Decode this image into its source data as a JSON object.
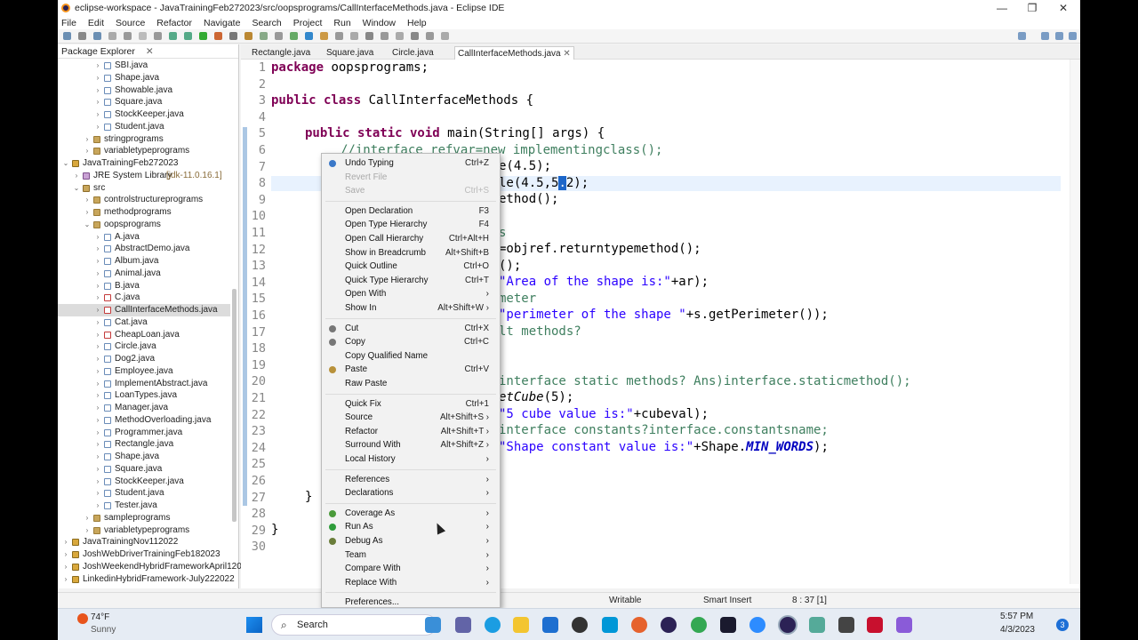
{
  "titlebar": {
    "title": "eclipse-workspace - JavaTrainingFeb272023/src/oopsprograms/CallInterfaceMethods.java - Eclipse IDE",
    "minimize": "—",
    "maximize": "❐",
    "close": "✕"
  },
  "menubar": [
    "File",
    "Edit",
    "Source",
    "Refactor",
    "Navigate",
    "Search",
    "Project",
    "Run",
    "Window",
    "Help"
  ],
  "package_explorer": {
    "title": "Package Explorer",
    "close": "✕",
    "rows": [
      {
        "label": "SBI.java",
        "indent": 3,
        "icon": "java",
        "arrow": ">"
      },
      {
        "label": "Shape.java",
        "indent": 3,
        "icon": "java",
        "arrow": ">"
      },
      {
        "label": "Showable.java",
        "indent": 3,
        "icon": "java",
        "arrow": ">"
      },
      {
        "label": "Square.java",
        "indent": 3,
        "icon": "java",
        "arrow": ">"
      },
      {
        "label": "StockKeeper.java",
        "indent": 3,
        "icon": "java",
        "arrow": ">"
      },
      {
        "label": "Student.java",
        "indent": 3,
        "icon": "java",
        "arrow": ">"
      },
      {
        "label": "stringprograms",
        "indent": 2,
        "icon": "pkg",
        "arrow": ">"
      },
      {
        "label": "variabletypeprograms",
        "indent": 2,
        "icon": "pkg",
        "arrow": ">"
      },
      {
        "label": "JavaTrainingFeb272023",
        "indent": 0,
        "icon": "proj",
        "arrow": "v"
      },
      {
        "label": "JRE System Library",
        "extra": "[jdk-11.0.16.1]",
        "indent": 1,
        "icon": "jre",
        "arrow": ">"
      },
      {
        "label": "src",
        "indent": 1,
        "icon": "src",
        "arrow": "v"
      },
      {
        "label": "controlstructureprograms",
        "indent": 2,
        "icon": "pkg",
        "arrow": ">"
      },
      {
        "label": "methodprograms",
        "indent": 2,
        "icon": "pkg",
        "arrow": ">"
      },
      {
        "label": "oopsprograms",
        "indent": 2,
        "icon": "pkg",
        "arrow": "v"
      },
      {
        "label": "A.java",
        "indent": 3,
        "icon": "java",
        "arrow": ">"
      },
      {
        "label": "AbstractDemo.java",
        "indent": 3,
        "icon": "java",
        "arrow": ">"
      },
      {
        "label": "Album.java",
        "indent": 3,
        "icon": "java",
        "arrow": ">"
      },
      {
        "label": "Animal.java",
        "indent": 3,
        "icon": "java",
        "arrow": ">"
      },
      {
        "label": "B.java",
        "indent": 3,
        "icon": "java",
        "arrow": ">"
      },
      {
        "label": "C.java",
        "indent": 3,
        "icon": "err",
        "arrow": ">"
      },
      {
        "label": "CallInterfaceMethods.java",
        "indent": 3,
        "icon": "err",
        "arrow": ">",
        "selected": true
      },
      {
        "label": "Cat.java",
        "indent": 3,
        "icon": "java",
        "arrow": ">"
      },
      {
        "label": "CheapLoan.java",
        "indent": 3,
        "icon": "err",
        "arrow": ">"
      },
      {
        "label": "Circle.java",
        "indent": 3,
        "icon": "java",
        "arrow": ">"
      },
      {
        "label": "Dog2.java",
        "indent": 3,
        "icon": "java",
        "arrow": ">"
      },
      {
        "label": "Employee.java",
        "indent": 3,
        "icon": "java",
        "arrow": ">"
      },
      {
        "label": "ImplementAbstract.java",
        "indent": 3,
        "icon": "java",
        "arrow": ">"
      },
      {
        "label": "LoanTypes.java",
        "indent": 3,
        "icon": "java",
        "arrow": ">"
      },
      {
        "label": "Manager.java",
        "indent": 3,
        "icon": "java",
        "arrow": ">"
      },
      {
        "label": "MethodOverloading.java",
        "indent": 3,
        "icon": "java",
        "arrow": ">"
      },
      {
        "label": "Programmer.java",
        "indent": 3,
        "icon": "java",
        "arrow": ">"
      },
      {
        "label": "Rectangle.java",
        "indent": 3,
        "icon": "java",
        "arrow": ">"
      },
      {
        "label": "Shape.java",
        "indent": 3,
        "icon": "java",
        "arrow": ">"
      },
      {
        "label": "Square.java",
        "indent": 3,
        "icon": "java",
        "arrow": ">"
      },
      {
        "label": "StockKeeper.java",
        "indent": 3,
        "icon": "java",
        "arrow": ">"
      },
      {
        "label": "Student.java",
        "indent": 3,
        "icon": "java",
        "arrow": ">"
      },
      {
        "label": "Tester.java",
        "indent": 3,
        "icon": "java",
        "arrow": ">"
      },
      {
        "label": "sampleprograms",
        "indent": 2,
        "icon": "pkg",
        "arrow": ">"
      },
      {
        "label": "variabletypeprograms",
        "indent": 2,
        "icon": "pkg",
        "arrow": ">"
      },
      {
        "label": "JavaTrainingNov112022",
        "indent": 0,
        "icon": "proj",
        "arrow": ">"
      },
      {
        "label": "JoshWebDriverTrainingFeb182023",
        "indent": 0,
        "icon": "proj",
        "arrow": ">"
      },
      {
        "label": "JoshWeekendHybridFrameworkApril12023",
        "indent": 0,
        "icon": "proj",
        "arrow": ">"
      },
      {
        "label": "LinkedinHybridFramework-July222022",
        "indent": 0,
        "icon": "proj",
        "arrow": ">"
      }
    ]
  },
  "editor": {
    "tabs": [
      {
        "label": "Rectangle.java"
      },
      {
        "label": "Square.java"
      },
      {
        "label": "Circle.java"
      },
      {
        "label": "CallInterfaceMethods.java",
        "active": true
      }
    ],
    "line_numbers": [
      "1",
      "2",
      "3",
      "4",
      "5",
      "6",
      "7",
      "8",
      "9",
      "10",
      "11",
      "12",
      "13",
      "14",
      "15",
      "16",
      "17",
      "18",
      "19",
      "20",
      "21",
      "22",
      "23",
      "24",
      "25",
      "26",
      "27",
      "28",
      "29",
      "30"
    ],
    "code": {
      "l1_kw": "package",
      "l1_rest": " oopsprograms;",
      "l3_kw": "public class",
      "l3_rest": " CallInterfaceMethods {",
      "l5_kw": "public static void",
      "l5_rest": " main(String[] args) {",
      "l6": "//interface refvar=new implementingclass();",
      "l7": "e(4.5);",
      "l8_a": "le(4.5,5",
      "l8_sel": ".",
      "l8_b": "2);",
      "l9": "ethod();",
      "l11": "s",
      "l12": "=objref.returntypemethod();",
      "l13": "();",
      "l14_str": "\"Area of the shape is:\"",
      "l14_rest": "+ar);",
      "l15": "meter",
      "l16_str": "\"perimeter of the shape \"",
      "l16_rest": "+s.getPerimeter());",
      "l17": "lt methods?",
      "l20": "interface static methods? Ans)interface.staticmethod();",
      "l21_it": "etCube",
      "l21_rest": "(5);",
      "l22_str": "\"5 cube value is:\"",
      "l22_rest": "+cubeval);",
      "l23": "interface constants?interface.constantsname;",
      "l24_str": "\"Shape constant value is:\"",
      "l24_mid": "+Shape.",
      "l24_fld": "MIN_WORDS",
      "l24_end": ");",
      "l27": "}",
      "l29": "}"
    }
  },
  "context_menu": [
    {
      "label": "Undo Typing",
      "key": "Ctrl+Z",
      "icon": "undo"
    },
    {
      "label": "Revert File",
      "disabled": true
    },
    {
      "label": "Save",
      "key": "Ctrl+S",
      "disabled": true
    },
    {
      "sep": true
    },
    {
      "label": "Open Declaration",
      "key": "F3"
    },
    {
      "label": "Open Type Hierarchy",
      "key": "F4"
    },
    {
      "label": "Open Call Hierarchy",
      "key": "Ctrl+Alt+H"
    },
    {
      "label": "Show in Breadcrumb",
      "key": "Alt+Shift+B"
    },
    {
      "label": "Quick Outline",
      "key": "Ctrl+O"
    },
    {
      "label": "Quick Type Hierarchy",
      "key": "Ctrl+T"
    },
    {
      "label": "Open With",
      "sub": true
    },
    {
      "label": "Show In",
      "key": "Alt+Shift+W ›"
    },
    {
      "sep": true
    },
    {
      "label": "Cut",
      "key": "Ctrl+X",
      "icon": "cut"
    },
    {
      "label": "Copy",
      "key": "Ctrl+C",
      "icon": "copy"
    },
    {
      "label": "Copy Qualified Name"
    },
    {
      "label": "Paste",
      "key": "Ctrl+V",
      "icon": "paste"
    },
    {
      "label": "Raw Paste"
    },
    {
      "sep": true
    },
    {
      "label": "Quick Fix",
      "key": "Ctrl+1"
    },
    {
      "label": "Source",
      "key": "Alt+Shift+S ›"
    },
    {
      "label": "Refactor",
      "key": "Alt+Shift+T ›"
    },
    {
      "label": "Surround With",
      "key": "Alt+Shift+Z ›"
    },
    {
      "label": "Local History",
      "sub": true
    },
    {
      "sep": true
    },
    {
      "label": "References",
      "sub": true
    },
    {
      "label": "Declarations",
      "sub": true
    },
    {
      "sep": true
    },
    {
      "label": "Coverage As",
      "sub": true,
      "icon": "coverage"
    },
    {
      "label": "Run As",
      "sub": true,
      "icon": "run"
    },
    {
      "label": "Debug As",
      "sub": true,
      "icon": "debug"
    },
    {
      "label": "Team",
      "sub": true
    },
    {
      "label": "Compare With",
      "sub": true
    },
    {
      "label": "Replace With",
      "sub": true
    },
    {
      "sep": true
    },
    {
      "label": "Preferences..."
    }
  ],
  "statusbar": {
    "writable": "Writable",
    "insert": "Smart Insert",
    "position": "8 : 37 [1]"
  },
  "taskbar": {
    "weather_temp": "74°F",
    "weather_desc": "Sunny",
    "search": "Search",
    "time": "5:57 PM",
    "date": "4/3/2023",
    "notif": "3"
  },
  "colors": {
    "keyword": "#7f0055",
    "string": "#2a00ff",
    "comment": "#3f7f5f",
    "selection": "#1c66c9"
  }
}
